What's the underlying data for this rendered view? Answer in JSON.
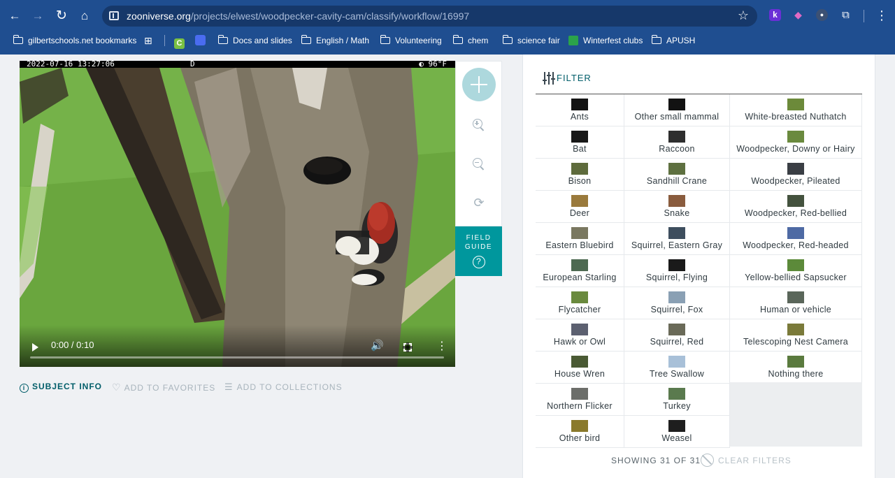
{
  "browser": {
    "url_host": "zooniverse.org",
    "url_path": "/projects/elwest/woodpecker-cavity-cam/classify/workflow/16997",
    "extensions": [
      {
        "name": "k-extension-icon",
        "letter": "k",
        "color": "#6b2fd6"
      },
      {
        "name": "camera-extension-icon",
        "letter": "◆",
        "color": "#d94fb4"
      },
      {
        "name": "dots-extension-icon",
        "letter": "●",
        "color": "#4a5e7e"
      }
    ]
  },
  "bookmarks": [
    {
      "label": "gilbertschools.net bookmarks"
    },
    {
      "label": "Docs and slides"
    },
    {
      "label": "English / Math"
    },
    {
      "label": "Volunteering"
    },
    {
      "label": "chem"
    },
    {
      "label": "science fair"
    },
    {
      "label": "Winterfest clubs"
    },
    {
      "label": "APUSH"
    }
  ],
  "video": {
    "timestamp": "2022-07-16 13:27:06",
    "mode": "D",
    "temperature": "◐  96°F",
    "time": "0:00 / 0:10",
    "progress": 0
  },
  "field_guide": {
    "line1": "FIELD",
    "line2": "GUIDE",
    "icon": "?"
  },
  "meta": {
    "subject_info": "SUBJECT INFO",
    "add_favorites": "ADD TO FAVORITES",
    "add_collections": "ADD TO COLLECTIONS"
  },
  "task": {
    "filter_label": "FILTER",
    "showing": "SHOWING 31 OF 31",
    "clear_filters": "CLEAR FILTERS",
    "choices": [
      {
        "label": "Ants",
        "thumb": "#141414"
      },
      {
        "label": "Bat",
        "thumb": "#181818"
      },
      {
        "label": "Bison",
        "thumb": "#5e6b3c"
      },
      {
        "label": "Deer",
        "thumb": "#9a7a3c"
      },
      {
        "label": "Eastern Bluebird",
        "thumb": "#7a7860"
      },
      {
        "label": "European Starling",
        "thumb": "#4e6a52"
      },
      {
        "label": "Flycatcher",
        "thumb": "#6a8a3e"
      },
      {
        "label": "Hawk or Owl",
        "thumb": "#5c6070"
      },
      {
        "label": "House Wren",
        "thumb": "#4a5a34"
      },
      {
        "label": "Northern Flicker",
        "thumb": "#6c6e6a"
      },
      {
        "label": "Other bird",
        "thumb": "#8a7a2c"
      },
      {
        "label": "Other small mammal",
        "thumb": "#121212"
      },
      {
        "label": "Raccoon",
        "thumb": "#2e2e2e"
      },
      {
        "label": "Sandhill Crane",
        "thumb": "#5e7040"
      },
      {
        "label": "Snake",
        "thumb": "#8a5c3e"
      },
      {
        "label": "Squirrel, Eastern Gray",
        "thumb": "#3e4e5e"
      },
      {
        "label": "Squirrel, Flying",
        "thumb": "#1a1a1a"
      },
      {
        "label": "Squirrel, Fox",
        "thumb": "#8aa0b4"
      },
      {
        "label": "Squirrel, Red",
        "thumb": "#6a6a58"
      },
      {
        "label": "Tree Swallow",
        "thumb": "#a8c0d8"
      },
      {
        "label": "Turkey",
        "thumb": "#5a7a4e"
      },
      {
        "label": "Weasel",
        "thumb": "#1e1e1e"
      },
      {
        "label": "White-breasted Nuthatch",
        "thumb": "#6c8a3a"
      },
      {
        "label": "Woodpecker, Downy or Hairy",
        "thumb": "#6a8a3e"
      },
      {
        "label": "Woodpecker, Pileated",
        "thumb": "#3a3e44"
      },
      {
        "label": "Woodpecker, Red-bellied",
        "thumb": "#44523e"
      },
      {
        "label": "Woodpecker, Red-headed",
        "thumb": "#4e6aa4"
      },
      {
        "label": "Yellow-bellied Sapsucker",
        "thumb": "#5c8a3a"
      },
      {
        "label": "Human or vehicle",
        "thumb": "#5a665a"
      },
      {
        "label": "Telescoping Nest Camera",
        "thumb": "#7a7a3a"
      },
      {
        "label": "Nothing there",
        "thumb": "#5a7a3e"
      }
    ]
  },
  "colors": {
    "accent": "#00979d",
    "link": "#005d69",
    "chrome": "#1f4e90"
  }
}
